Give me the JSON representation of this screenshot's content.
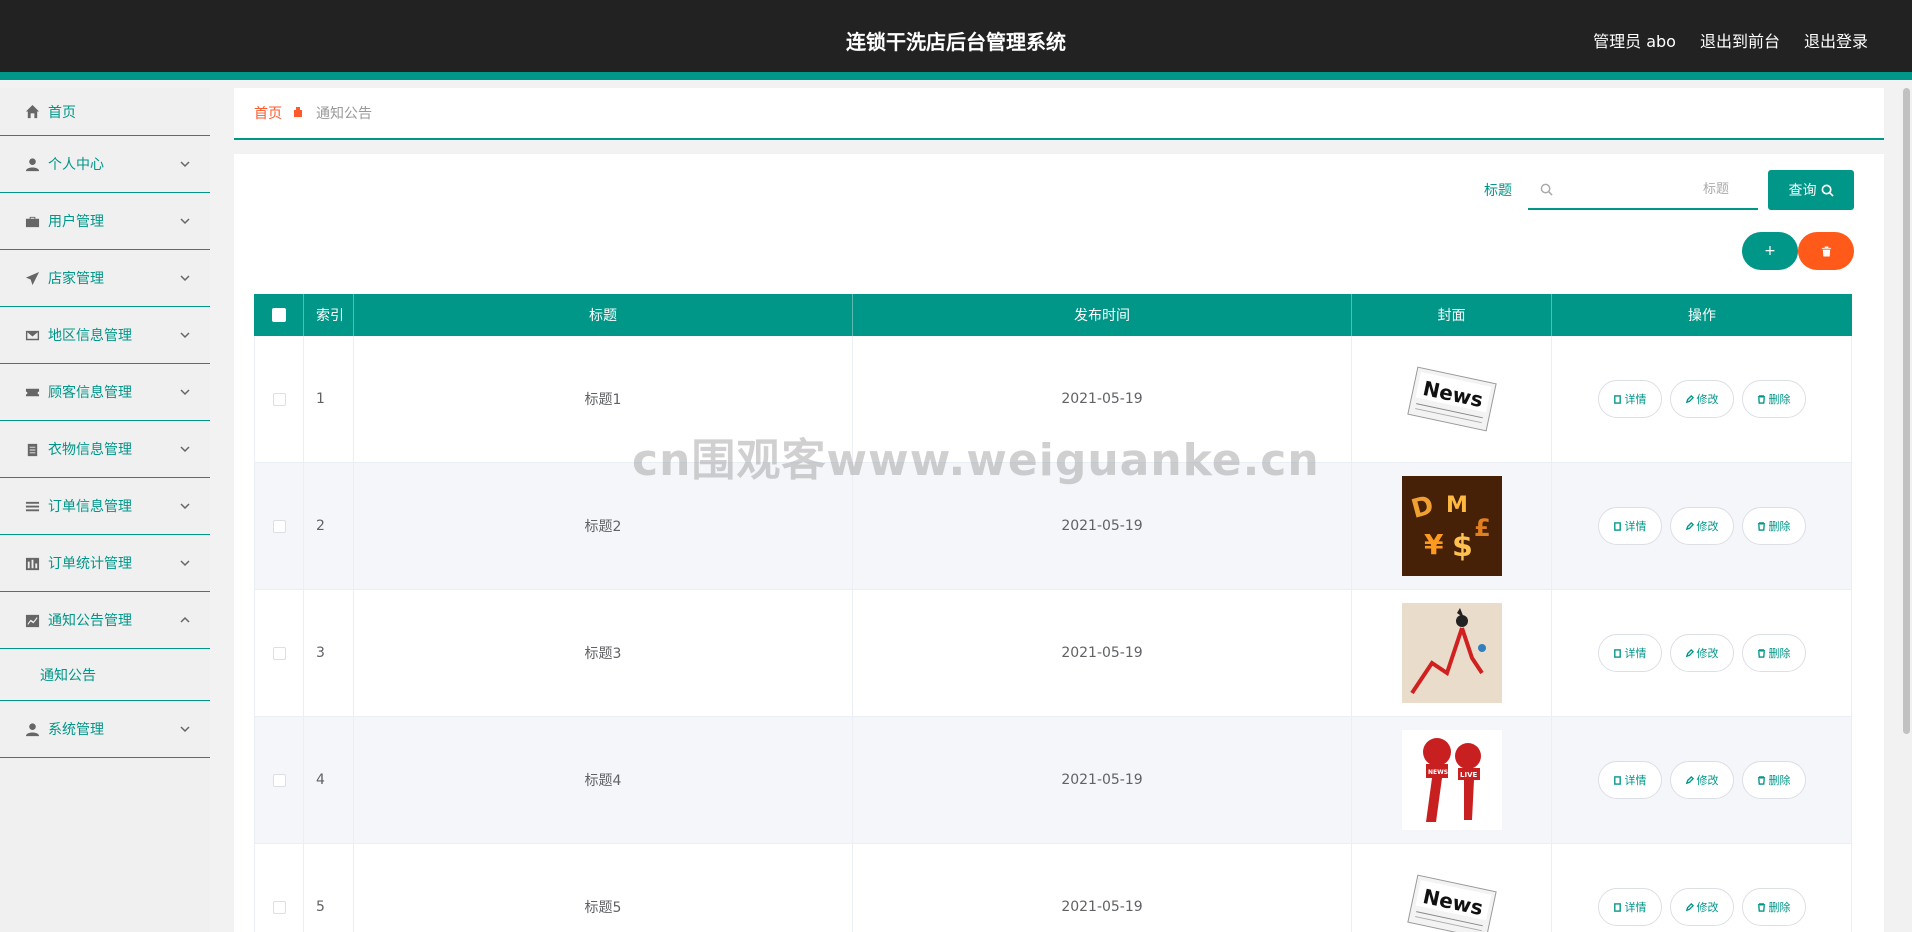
{
  "header": {
    "title": "连锁干洗店后台管理系统",
    "user": "管理员 abo",
    "front_link": "退出到前台",
    "logout": "退出登录"
  },
  "sidebar": {
    "items": [
      {
        "label": "首页",
        "icon": "home-icon"
      },
      {
        "label": "个人中心",
        "icon": "user-icon"
      },
      {
        "label": "用户管理",
        "icon": "briefcase-icon"
      },
      {
        "label": "店家管理",
        "icon": "send-icon"
      },
      {
        "label": "地区信息管理",
        "icon": "mail-icon"
      },
      {
        "label": "顾客信息管理",
        "icon": "ticket-icon"
      },
      {
        "label": "衣物信息管理",
        "icon": "clipboard-icon"
      },
      {
        "label": "订单信息管理",
        "icon": "list-icon"
      },
      {
        "label": "订单统计管理",
        "icon": "bar-chart-icon"
      },
      {
        "label": "通知公告管理",
        "icon": "line-chart-icon",
        "expanded": true,
        "children": [
          {
            "label": "通知公告"
          }
        ]
      },
      {
        "label": "系统管理",
        "icon": "user-icon"
      }
    ]
  },
  "breadcrumb": {
    "home": "首页",
    "current": "通知公告"
  },
  "search": {
    "label": "标题",
    "placeholder": "标题",
    "button": "查询"
  },
  "actions": {
    "add": "+",
    "delete_icon": "trash-icon"
  },
  "table": {
    "headers": {
      "index": "索引",
      "title": "标题",
      "time": "发布时间",
      "cover": "封面",
      "ops": "操作"
    },
    "rows": [
      {
        "index": "1",
        "title": "标题1",
        "time": "2021-05-19",
        "cover": "news-paper"
      },
      {
        "index": "2",
        "title": "标题2",
        "time": "2021-05-19",
        "cover": "currency-symbols"
      },
      {
        "index": "3",
        "title": "标题3",
        "time": "2021-05-19",
        "cover": "falling-chart"
      },
      {
        "index": "4",
        "title": "标题4",
        "time": "2021-05-19",
        "cover": "microphones"
      },
      {
        "index": "5",
        "title": "标题5",
        "time": "2021-05-19",
        "cover": "news-paper"
      }
    ],
    "ops": {
      "detail": "详情",
      "edit": "修改",
      "delete": "删除"
    }
  },
  "watermark": "cn围观客www.weiguanke.cn",
  "colors": {
    "accent": "#009688",
    "header_bg": "#222222",
    "danger": "#ff5a1a",
    "breadcrumb_home": "#ff5a2c"
  }
}
